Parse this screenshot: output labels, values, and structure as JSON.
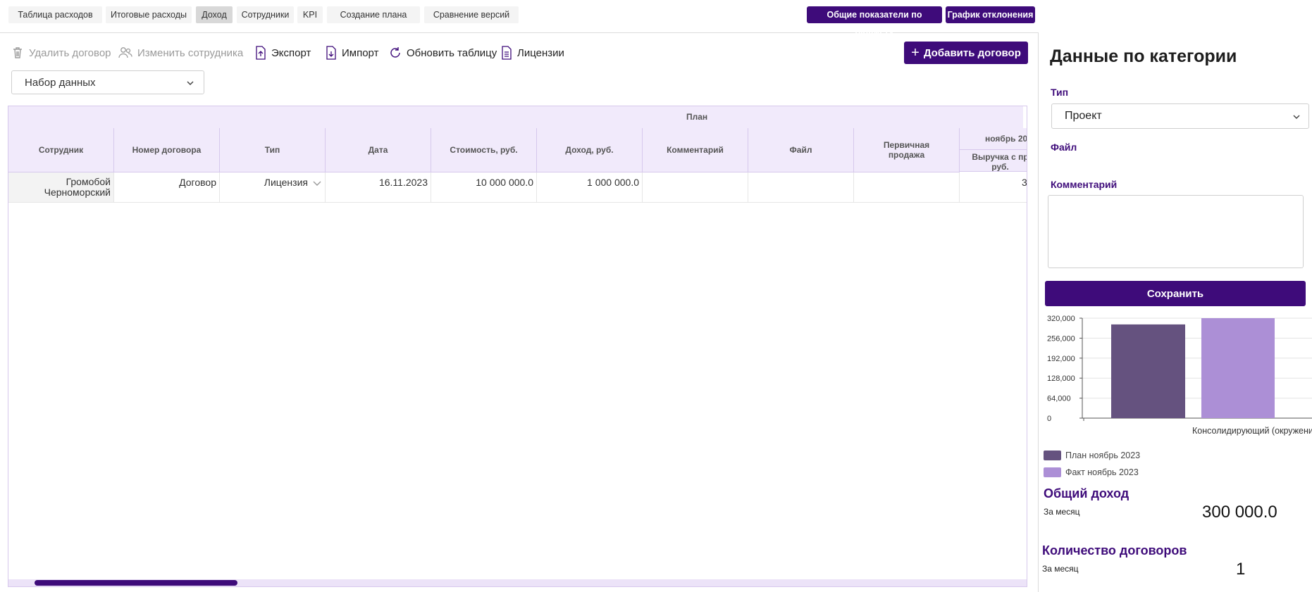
{
  "tabs": [
    {
      "label": "Таблица расходов"
    },
    {
      "label": "Итоговые расходы"
    },
    {
      "label": "Доход"
    },
    {
      "label": "Сотрудники"
    },
    {
      "label": "KPI"
    },
    {
      "label": "Создание плана"
    },
    {
      "label": "Сравнение версий"
    }
  ],
  "active_tab": "Доход",
  "header_buttons": {
    "budget": "Общие показатели по бюджету",
    "deviation": "График отклонения"
  },
  "toolbar": {
    "delete": "Удалить договор",
    "change_employee": "Изменить сотрудника",
    "export": "Экспорт",
    "import": "Импорт",
    "refresh": "Обновить таблицу",
    "licenses": "Лицензии",
    "add": "Добавить договор"
  },
  "dataset_select": {
    "value": "Набор данных"
  },
  "table": {
    "group_header": "План",
    "columns": [
      "Сотрудник",
      "Номер договора",
      "Тип",
      "Дата",
      "Стоимость, руб.",
      "Доход, руб.",
      "Комментарий",
      "Файл",
      "Первичная продажа"
    ],
    "month_header": "ноябрь 20",
    "month_sub": "Выручка с пр руб.",
    "rows": [
      {
        "employee": "Громобой Черноморский",
        "contract": "Договор",
        "type": "Лицензия",
        "date": "16.11.2023",
        "cost": "10 000 000.0",
        "income": "1 000 000.0",
        "comment": "",
        "file": "",
        "primary": "",
        "month_value": "3"
      }
    ]
  },
  "side": {
    "title": "Данные по категории",
    "type_label": "Тип",
    "type_value": "Проект",
    "file_label": "Файл",
    "comment_label": "Комментарий",
    "save": "Сохранить"
  },
  "chart_data": {
    "type": "bar",
    "categories": [
      "Консолидирующий (окружени"
    ],
    "series": [
      {
        "name": "План ноябрь 2023",
        "values": [
          300000
        ],
        "color": "#65527f"
      },
      {
        "name": "Факт ноябрь 2023",
        "values": [
          320000
        ],
        "color": "#ac8fd6"
      }
    ],
    "yticks": [
      "0",
      "64,000",
      "128,000",
      "192,000",
      "256,000",
      "320,000"
    ],
    "ylim": [
      0,
      320000
    ],
    "grid": true,
    "legend": "bottom-left"
  },
  "kpi": {
    "income_title": "Общий доход",
    "income_period": "За месяц",
    "income_value": "300 000.0",
    "count_title": "Количество договоров",
    "count_period": "За месяц",
    "count_value": "1"
  },
  "colors": {
    "accent": "#3e0b7a",
    "header_bg": "#f1eafb"
  }
}
